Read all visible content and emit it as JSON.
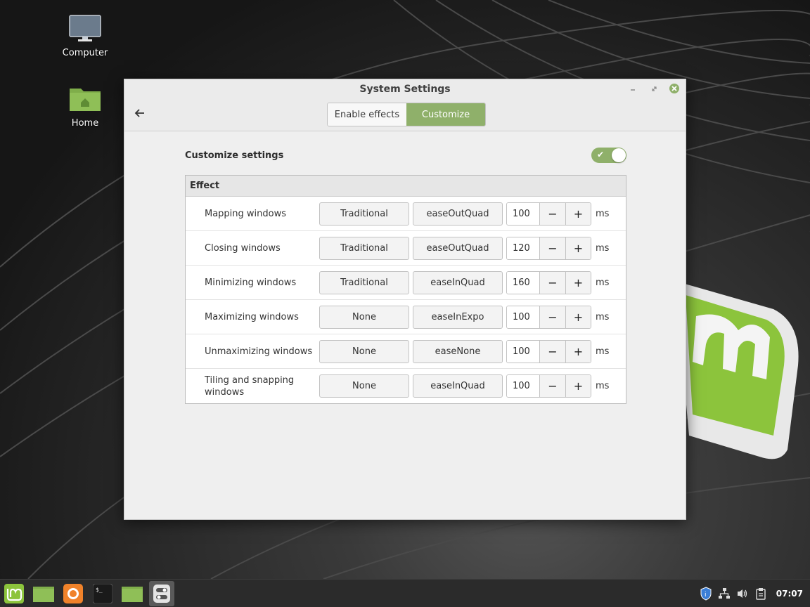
{
  "desktop": {
    "icons": [
      {
        "label": "Computer"
      },
      {
        "label": "Home"
      }
    ]
  },
  "window": {
    "title": "System Settings",
    "tabs": [
      {
        "label": "Enable effects",
        "active": false
      },
      {
        "label": "Customize",
        "active": true
      }
    ],
    "customize": {
      "heading": "Customize settings",
      "enabled": true
    },
    "table": {
      "header": "Effect",
      "unit": "ms",
      "rows": [
        {
          "name": "Mapping windows",
          "effect": "Traditional",
          "easing": "easeOutQuad",
          "duration": "100"
        },
        {
          "name": "Closing windows",
          "effect": "Traditional",
          "easing": "easeOutQuad",
          "duration": "120"
        },
        {
          "name": "Minimizing windows",
          "effect": "Traditional",
          "easing": "easeInQuad",
          "duration": "160"
        },
        {
          "name": "Maximizing windows",
          "effect": "None",
          "easing": "easeInExpo",
          "duration": "100"
        },
        {
          "name": "Unmaximizing windows",
          "effect": "None",
          "easing": "easeNone",
          "duration": "100"
        },
        {
          "name": "Tiling and snapping windows",
          "effect": "None",
          "easing": "easeInQuad",
          "duration": "100"
        }
      ]
    }
  },
  "taskbar": {
    "clock": "07:07"
  },
  "colors": {
    "accent": "#8fb06a"
  }
}
